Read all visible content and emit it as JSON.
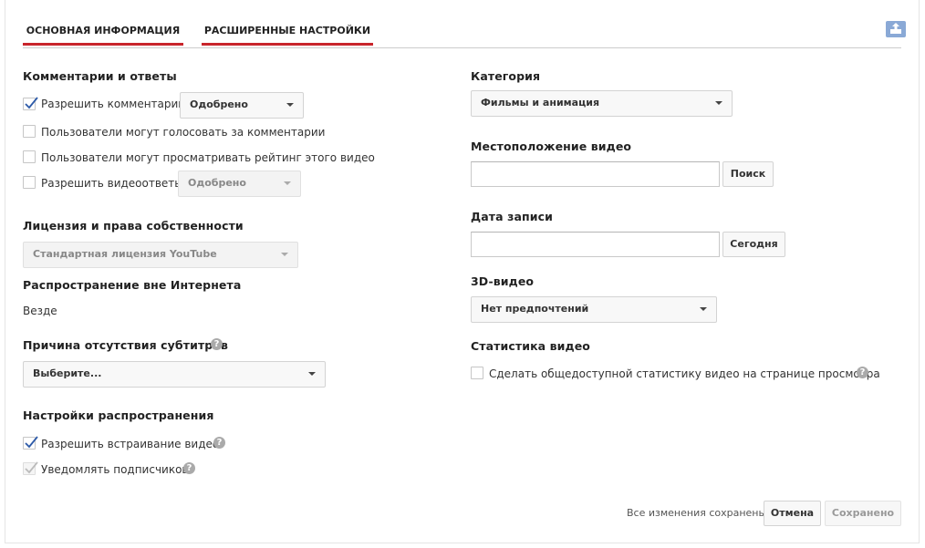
{
  "tabs": [
    "ОСНОВНАЯ ИНФОРМАЦИЯ",
    "РАСШИРЕННЫЕ НАСТРОЙКИ"
  ],
  "comments": {
    "heading": "Комментарии и ответы",
    "allow_comments": "Разрешить комментарии",
    "allow_comments_value": "Одобрено",
    "users_vote": "Пользователи могут голосовать за комментарии",
    "users_view_rating": "Пользователи могут просматривать рейтинг этого видео",
    "allow_video_replies": "Разрешить видеоответы",
    "video_replies_value": "Одобрено"
  },
  "license": {
    "heading": "Лицензия и права собственности",
    "value": "Стандартная лицензия YouTube"
  },
  "offline": {
    "heading": "Распространение вне Интернета",
    "value": "Везде"
  },
  "captions": {
    "heading": "Причина отсутствия субтитров",
    "value": "Выберите..."
  },
  "distribution": {
    "heading": "Настройки распространения",
    "allow_embed": "Разрешить встраивание видео",
    "notify_subscribers": "Уведомлять подписчиков"
  },
  "category": {
    "heading": "Категория",
    "value": "Фильмы и анимация"
  },
  "location": {
    "heading": "Местоположение видео",
    "button": "Поиск",
    "value": ""
  },
  "record_date": {
    "heading": "Дата записи",
    "button": "Сегодня",
    "value": ""
  },
  "video3d": {
    "heading": "3D-видео",
    "value": "Нет предпочтений"
  },
  "stats": {
    "heading": "Статистика видео",
    "public_stats": "Сделать общедоступной статистику видео на странице просмотра"
  },
  "footer": {
    "status": "Все изменения сохранены.",
    "cancel": "Отмена",
    "saved": "Сохранено"
  },
  "icons": {
    "help": "?",
    "upload": "upload-icon"
  },
  "colors": {
    "tab_underline": "#c8242b"
  }
}
